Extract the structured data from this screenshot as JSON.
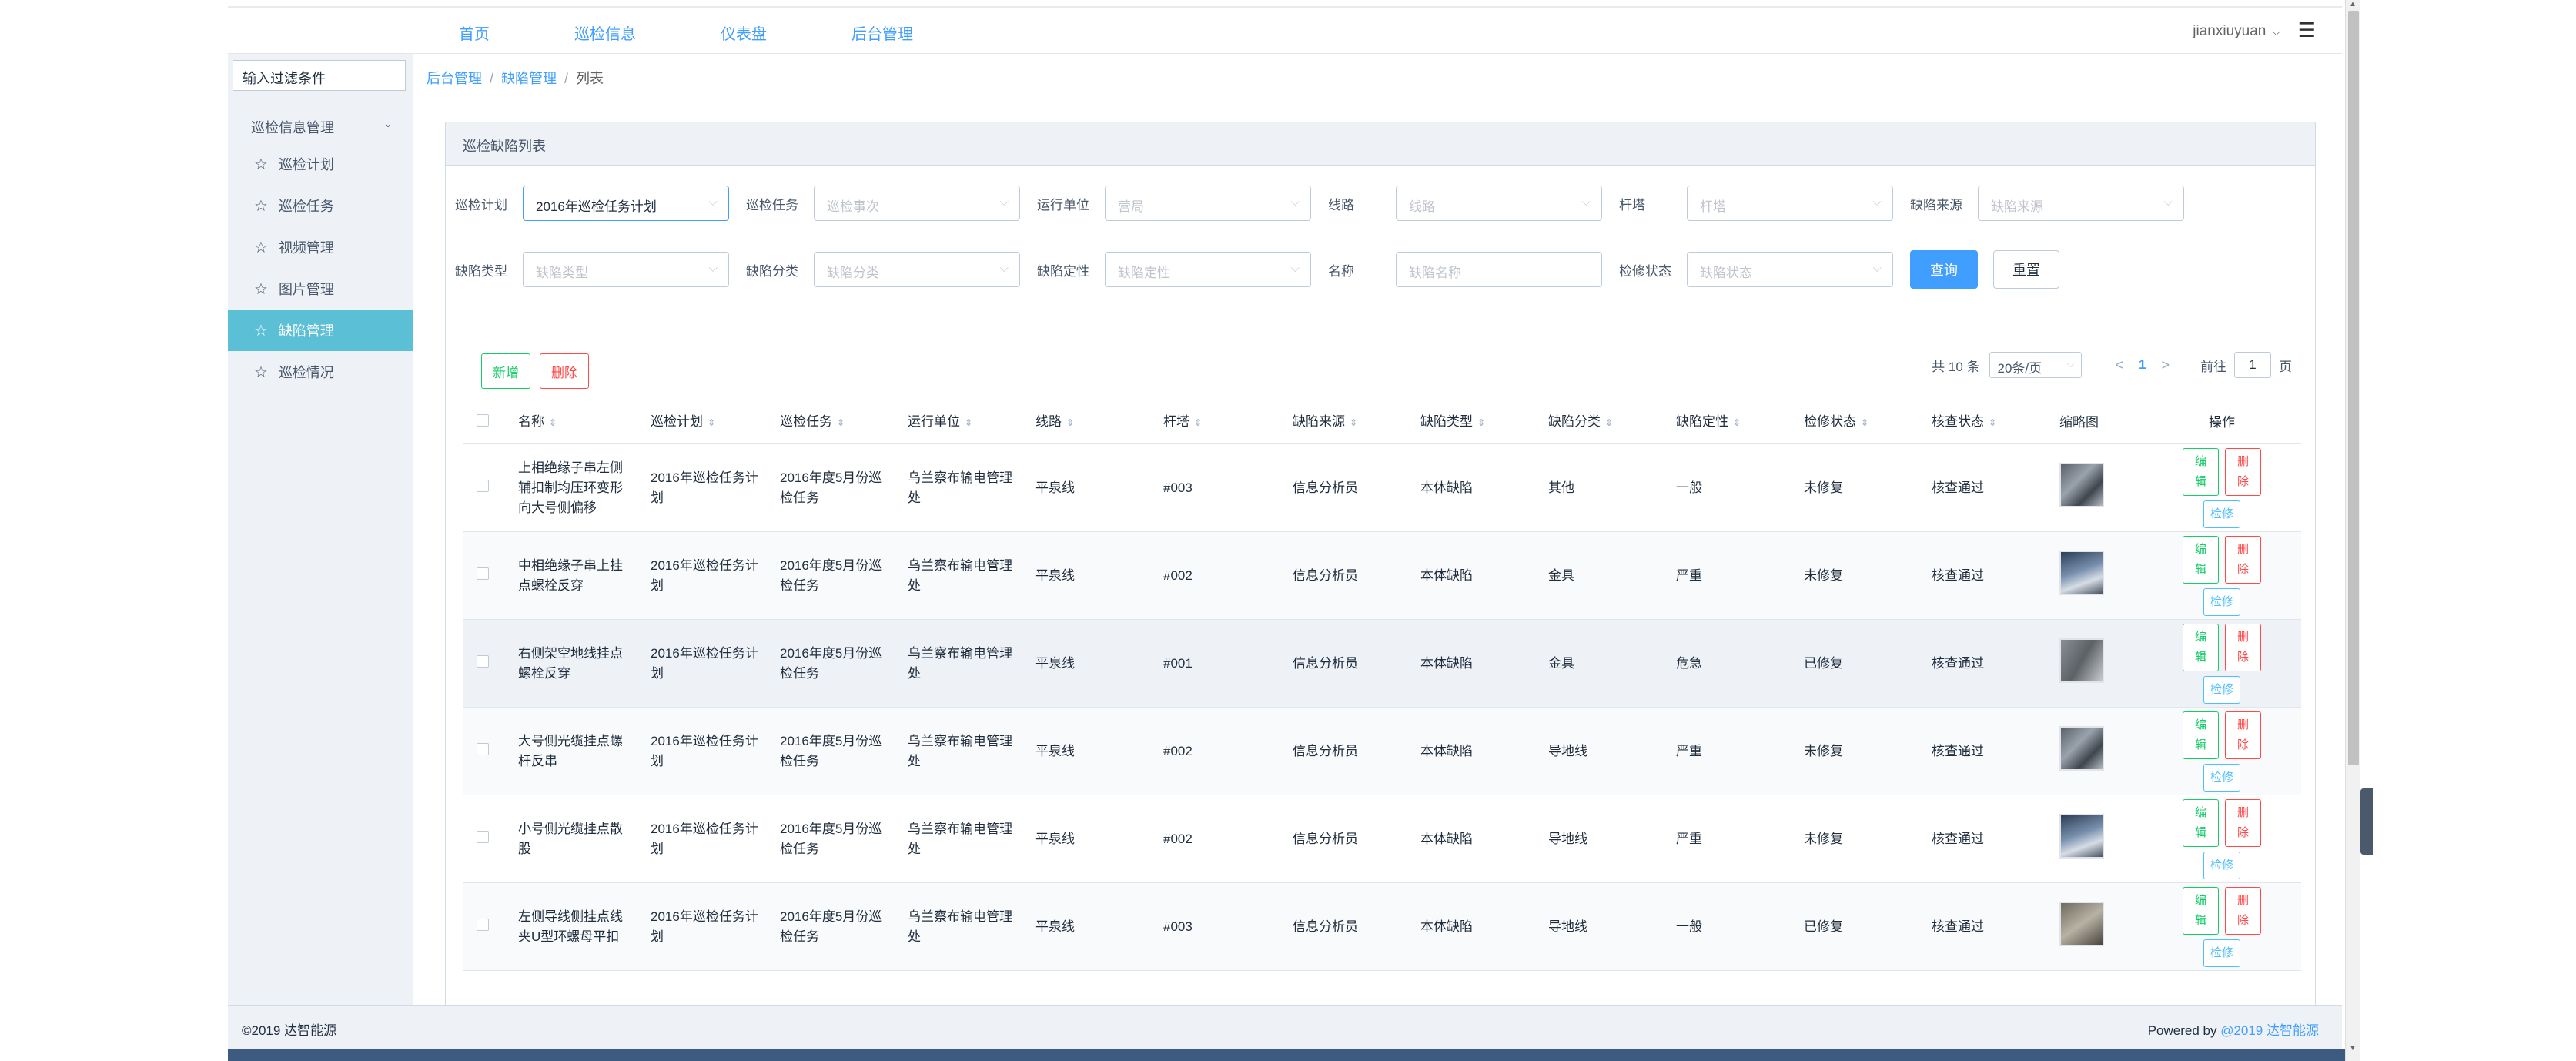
{
  "topnav": [
    "首页",
    "巡检信息",
    "仪表盘",
    "后台管理"
  ],
  "user": "jianxiuyuan",
  "sidebar": {
    "filter_placeholder": "输入过滤条件",
    "group_title": "巡检信息管理",
    "items": [
      {
        "label": "巡检计划",
        "active": false
      },
      {
        "label": "巡检任务",
        "active": false
      },
      {
        "label": "视频管理",
        "active": false
      },
      {
        "label": "图片管理",
        "active": false
      },
      {
        "label": "缺陷管理",
        "active": true
      },
      {
        "label": "巡检情况",
        "active": false
      }
    ]
  },
  "breadcrumb": [
    "后台管理",
    "缺陷管理",
    "列表"
  ],
  "panel_title": "巡检缺陷列表",
  "filters": {
    "row1": [
      {
        "label": "巡检计划",
        "value": "2016年巡检任务计划",
        "selected": true
      },
      {
        "label": "巡检任务",
        "value": "巡检事次",
        "selected": false
      },
      {
        "label": "运行单位",
        "value": "营局",
        "selected": false
      },
      {
        "label": "线路",
        "value": "线路",
        "selected": false
      },
      {
        "label": "杆塔",
        "value": "杆塔",
        "selected": false
      },
      {
        "label": "缺陷来源",
        "value": "缺陷来源",
        "selected": false
      }
    ],
    "row2": [
      {
        "label": "缺陷类型",
        "value": "缺陷类型",
        "selected": false
      },
      {
        "label": "缺陷分类",
        "value": "缺陷分类",
        "selected": false
      },
      {
        "label": "缺陷定性",
        "value": "缺陷定性",
        "selected": false
      },
      {
        "label": "名称",
        "value": "缺陷名称",
        "selected": false
      },
      {
        "label": "检修状态",
        "value": "缺陷状态",
        "selected": false
      }
    ],
    "query": "查询",
    "reset": "重置"
  },
  "toolbar": {
    "new": "新增",
    "delete": "删除"
  },
  "pager": {
    "total": "共 10 条",
    "size": "20条/页",
    "current": "1",
    "goto": "前往",
    "goto_value": "1",
    "page": "页"
  },
  "columns": [
    "名称",
    "巡检计划",
    "巡检任务",
    "运行单位",
    "线路",
    "杆塔",
    "缺陷来源",
    "缺陷类型",
    "缺陷分类",
    "缺陷定性",
    "检修状态",
    "核查状态",
    "缩略图",
    "操作"
  ],
  "ops": {
    "edit": "编辑",
    "delete": "删除",
    "repair": "检修"
  },
  "rows": [
    {
      "name": "上相绝缘子串左侧辅扣制均压环变形向大号侧偏移",
      "plan": "2016年巡检任务计划",
      "task": "2016年度5月份巡检任务",
      "unit": "乌兰察布输电管理处",
      "line": "平泉线",
      "tower": "#003",
      "src": "信息分析员",
      "dtype": "本体缺陷",
      "dcls": "其他",
      "dqual": "一般",
      "rstat": "未修复",
      "cstat": "核查通过"
    },
    {
      "name": "中相绝缘子串上挂点螺栓反穿",
      "plan": "2016年巡检任务计划",
      "task": "2016年度5月份巡检任务",
      "unit": "乌兰察布输电管理处",
      "line": "平泉线",
      "tower": "#002",
      "src": "信息分析员",
      "dtype": "本体缺陷",
      "dcls": "金具",
      "dqual": "严重",
      "rstat": "未修复",
      "cstat": "核查通过"
    },
    {
      "name": "右侧架空地线挂点螺栓反穿",
      "plan": "2016年巡检任务计划",
      "task": "2016年度5月份巡检任务",
      "unit": "乌兰察布输电管理处",
      "line": "平泉线",
      "tower": "#001",
      "src": "信息分析员",
      "dtype": "本体缺陷",
      "dcls": "金具",
      "dqual": "危急",
      "rstat": "已修复",
      "cstat": "核查通过"
    },
    {
      "name": "大号侧光缆挂点螺杆反串",
      "plan": "2016年巡检任务计划",
      "task": "2016年度5月份巡检任务",
      "unit": "乌兰察布输电管理处",
      "line": "平泉线",
      "tower": "#002",
      "src": "信息分析员",
      "dtype": "本体缺陷",
      "dcls": "导地线",
      "dqual": "严重",
      "rstat": "未修复",
      "cstat": "核查通过"
    },
    {
      "name": "小号侧光缆挂点散股",
      "plan": "2016年巡检任务计划",
      "task": "2016年度5月份巡检任务",
      "unit": "乌兰察布输电管理处",
      "line": "平泉线",
      "tower": "#002",
      "src": "信息分析员",
      "dtype": "本体缺陷",
      "dcls": "导地线",
      "dqual": "严重",
      "rstat": "未修复",
      "cstat": "核查通过"
    },
    {
      "name": "左侧导线侧挂点线夹U型环螺母平扣",
      "plan": "2016年巡检任务计划",
      "task": "2016年度5月份巡检任务",
      "unit": "乌兰察布输电管理处",
      "line": "平泉线",
      "tower": "#003",
      "src": "信息分析员",
      "dtype": "本体缺陷",
      "dcls": "导地线",
      "dqual": "一般",
      "rstat": "已修复",
      "cstat": "核查通过"
    }
  ],
  "footer": {
    "copy": "©2019 达智能源",
    "powered_prefix": "Powered by ",
    "powered_link": "@2019 达智能源"
  }
}
